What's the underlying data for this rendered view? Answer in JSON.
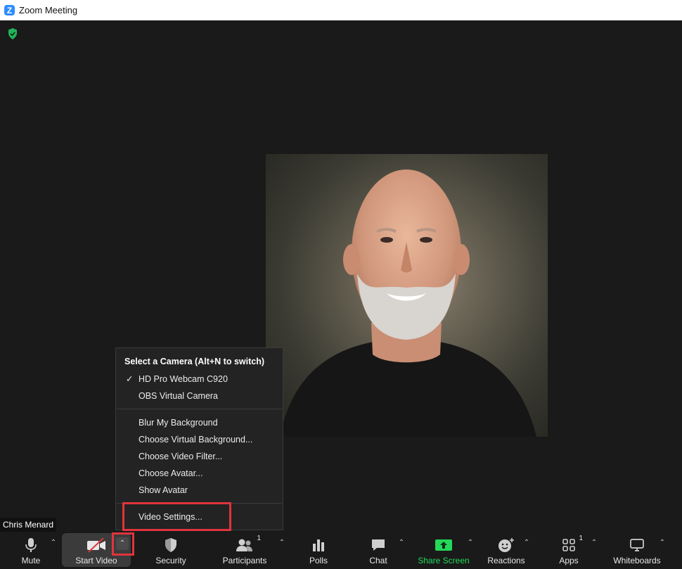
{
  "window": {
    "title": "Zoom Meeting"
  },
  "participant": {
    "name": "Chris Menard"
  },
  "camera_menu": {
    "header": "Select a Camera (Alt+N to switch)",
    "cameras": [
      {
        "label": "HD Pro Webcam C920",
        "checked": true
      },
      {
        "label": "OBS Virtual Camera",
        "checked": false
      }
    ],
    "options": [
      "Blur My Background",
      "Choose Virtual Background...",
      "Choose Video Filter...",
      "Choose Avatar...",
      "Show Avatar"
    ],
    "settings": "Video Settings..."
  },
  "toolbar": {
    "mute": "Mute",
    "start_video": "Start Video",
    "security": "Security",
    "participants": "Participants",
    "participants_count": "1",
    "polls": "Polls",
    "chat": "Chat",
    "share_screen": "Share Screen",
    "reactions": "Reactions",
    "apps": "Apps",
    "apps_count": "1",
    "whiteboards": "Whiteboards"
  },
  "colors": {
    "accent": "#2d8cff",
    "share": "#23d959",
    "highlight": "#e0343c",
    "secure": "#23b35a"
  },
  "icons": [
    "zoom-logo-icon",
    "shield-check-icon",
    "microphone-icon",
    "video-off-icon",
    "security-shield-icon",
    "participants-icon",
    "polls-icon",
    "chat-icon",
    "share-screen-icon",
    "reactions-icon",
    "apps-icon",
    "whiteboards-icon",
    "chevron-up-icon",
    "checkmark-icon"
  ]
}
